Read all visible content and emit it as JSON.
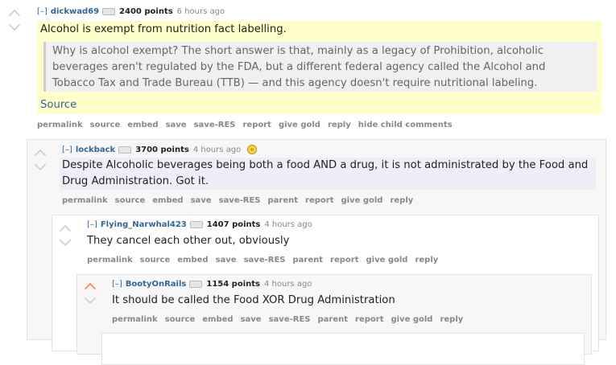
{
  "comments": [
    {
      "expand": "[–]",
      "author": "dickwad69",
      "points": "2400 points",
      "time": "6 hours ago",
      "body_line1": "Alcohol is exempt from nutrition fact labelling.",
      "quote": "Why is alcohol exempt? The short answer is that, mainly as a legacy of Prohibition, alcoholic beverages aren't regulated by the FDA, but a different federal agency called the Alcohol and Tobacco Tax and Trade Bureau (TTB) — and this agency doesn't require nutritional labeling.",
      "source_link": "Source",
      "buttons": [
        "permalink",
        "source",
        "embed",
        "save",
        "save-RES",
        "report",
        "give gold",
        "reply",
        "hide child comments"
      ]
    },
    {
      "expand": "[–]",
      "author": "lockback",
      "points": "3700 points",
      "time": "4 hours ago",
      "body": "Despite Alcoholic beverages being both a food AND a drug, it is not administrated by the Food and Drug Administration. Got it.",
      "buttons": [
        "permalink",
        "source",
        "embed",
        "save",
        "save-RES",
        "parent",
        "report",
        "give gold",
        "reply"
      ]
    },
    {
      "expand": "[–]",
      "author": "Flying_Narwhal423",
      "points": "1407 points",
      "time": "4 hours ago",
      "body": "They cancel each other out, obviously",
      "buttons": [
        "permalink",
        "source",
        "embed",
        "save",
        "save-RES",
        "parent",
        "report",
        "give gold",
        "reply"
      ]
    },
    {
      "expand": "[–]",
      "author": "BootyOnRails",
      "points": "1154 points",
      "time": "4 hours ago",
      "body": "It should be called the Food XOR Drug Administration",
      "buttons": [
        "permalink",
        "source",
        "embed",
        "save",
        "save-RES",
        "parent",
        "report",
        "give gold",
        "reply"
      ]
    }
  ],
  "colors": {
    "upvoted": "#ff8b60",
    "link": "#336699",
    "highlight": "#ffffcc"
  }
}
